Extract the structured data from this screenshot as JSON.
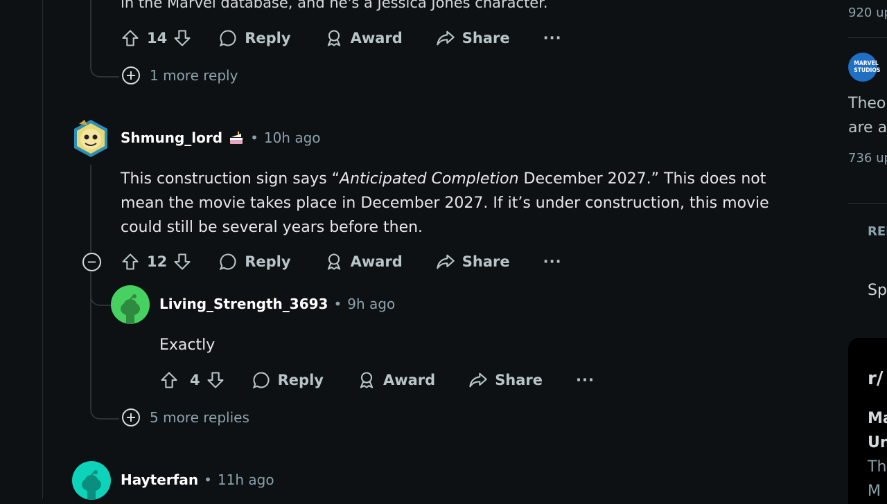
{
  "top_comment": {
    "partial_text": "in the Marvel database, and he's a Jessica Jones character.",
    "votes": "14",
    "more_replies": "1 more reply"
  },
  "actions": {
    "reply": "Reply",
    "award": "Award",
    "share": "Share",
    "more": "···"
  },
  "comment1": {
    "author": "Shmung_lord",
    "time": "10h ago",
    "body_before": "This construction sign says “",
    "body_italic": "Anticipated Completion",
    "body_after": " December 2027.” This does not mean the movie takes place in December 2027. If it’s under construction, this movie could still be several years before then.",
    "votes": "12"
  },
  "reply1": {
    "author": "Living_Strength_3693",
    "time": "9h ago",
    "body": "Exactly",
    "votes": "4",
    "more_replies": "5 more replies"
  },
  "comment2": {
    "author": "Hayterfan",
    "time": "11h ago"
  },
  "sidebar": {
    "upvotes_1": "920 up",
    "logo_text": "MARVEL STUDIOS",
    "title_line1": "Theo",
    "title_line2": "are a",
    "upvotes_2": "736 up",
    "section_label": "REI",
    "item_partial": "Sp",
    "sub_name": "r/",
    "sub_title1": "Ma",
    "sub_title2": "Un",
    "desc1": "Th",
    "desc2": "M"
  },
  "colors": {
    "background": "#0e1113",
    "thread_line": "#2a3236",
    "muted_text": "#8ba2ad",
    "avatar_green": "#46d160",
    "avatar_teal": "#0dd3bb"
  }
}
